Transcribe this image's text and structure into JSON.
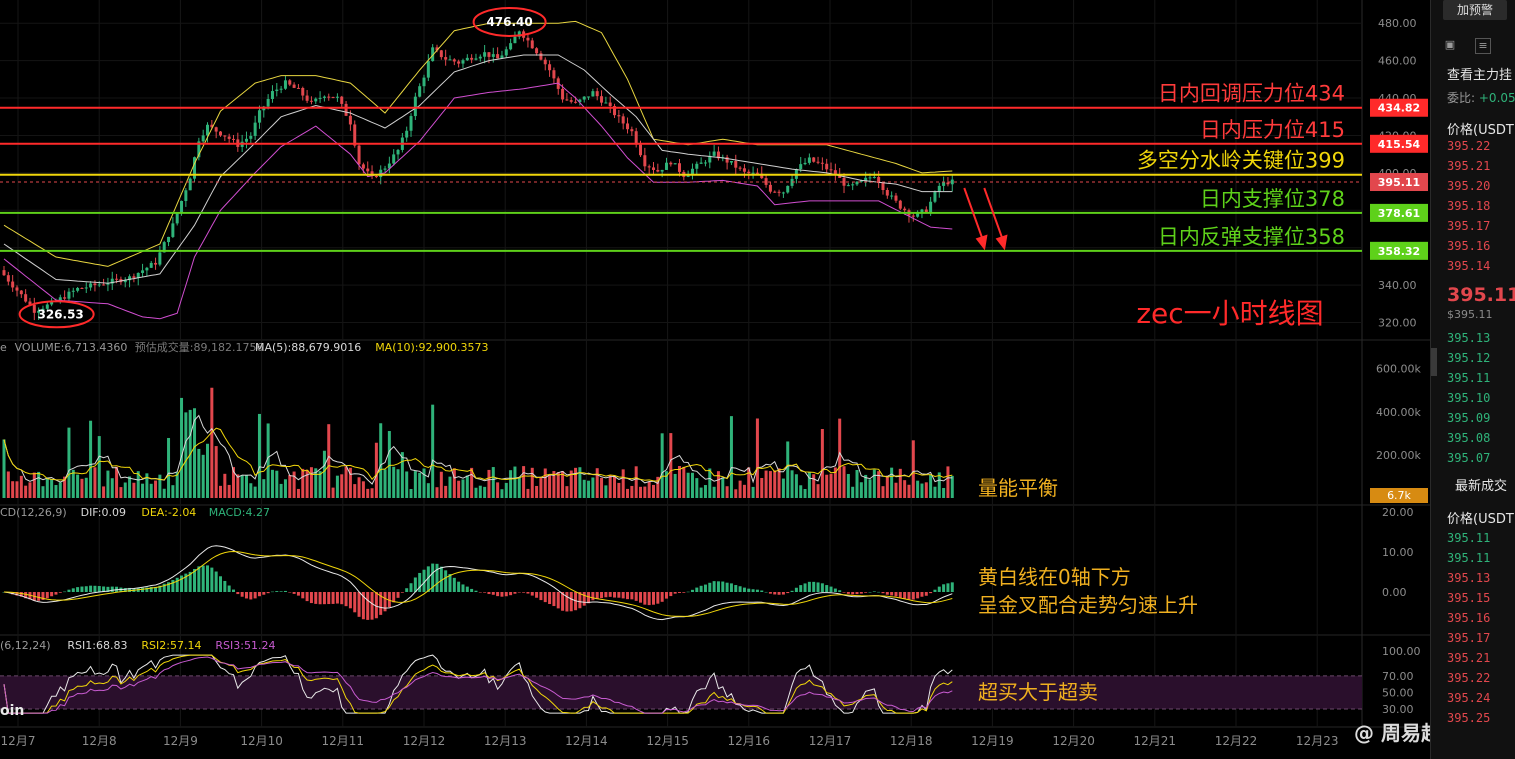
{
  "chart_data": {
    "type": "candlestick",
    "title": "zec一小时线图",
    "x_tick_labels": [
      "12月7",
      "12月8",
      "12月9",
      "12月10",
      "12月11",
      "12月12",
      "12月13",
      "12月14",
      "12月15",
      "12月16",
      "12月17",
      "12月18",
      "12月19",
      "12月20",
      "12月21",
      "12月22",
      "12月23"
    ],
    "price_axis": {
      "ticks": [
        "480.00",
        "460.00",
        "440.00",
        "420.00",
        "400.00",
        "380.00",
        "360.00",
        "340.00",
        "320.00"
      ],
      "range": [
        316,
        486
      ]
    },
    "key_prices": {
      "high": "476.40",
      "low": "326.53",
      "last": "395.11"
    },
    "price_path": [
      [
        0,
        348
      ],
      [
        3,
        340
      ],
      [
        6,
        332
      ],
      [
        8,
        326.53
      ],
      [
        12,
        330
      ],
      [
        18,
        338
      ],
      [
        24,
        341
      ],
      [
        30,
        344
      ],
      [
        36,
        352
      ],
      [
        40,
        372
      ],
      [
        44,
        398
      ],
      [
        46,
        418
      ],
      [
        48,
        425
      ],
      [
        52,
        420
      ],
      [
        55,
        415
      ],
      [
        58,
        420
      ],
      [
        60,
        432
      ],
      [
        63,
        443
      ],
      [
        66,
        448
      ],
      [
        69,
        444
      ],
      [
        72,
        437
      ],
      [
        75,
        442
      ],
      [
        78,
        440
      ],
      [
        81,
        427
      ],
      [
        83,
        405
      ],
      [
        86,
        397
      ],
      [
        89,
        403
      ],
      [
        92,
        412
      ],
      [
        94,
        423
      ],
      [
        96,
        440
      ],
      [
        98,
        452
      ],
      [
        100,
        466
      ],
      [
        103,
        461
      ],
      [
        106,
        459
      ],
      [
        109,
        462
      ],
      [
        112,
        464
      ],
      [
        115,
        461
      ],
      [
        118,
        468
      ],
      [
        120,
        476.4
      ],
      [
        124,
        465
      ],
      [
        127,
        455
      ],
      [
        130,
        440
      ],
      [
        133,
        437
      ],
      [
        137,
        443
      ],
      [
        140,
        437
      ],
      [
        143,
        429
      ],
      [
        146,
        422
      ],
      [
        149,
        405
      ],
      [
        152,
        401
      ],
      [
        155,
        406
      ],
      [
        158,
        399
      ],
      [
        162,
        405
      ],
      [
        165,
        410
      ],
      [
        169,
        405
      ],
      [
        172,
        400
      ],
      [
        175,
        399
      ],
      [
        178,
        391
      ],
      [
        181,
        390
      ],
      [
        184,
        402
      ],
      [
        187,
        407
      ],
      [
        190,
        404
      ],
      [
        193,
        399
      ],
      [
        196,
        392
      ],
      [
        199,
        395
      ],
      [
        202,
        399
      ],
      [
        205,
        389
      ],
      [
        208,
        382
      ],
      [
        211,
        377
      ],
      [
        214,
        380
      ],
      [
        217,
        393
      ],
      [
        219,
        395.11
      ]
    ],
    "bollinger": {
      "upper": [
        [
          0,
          372
        ],
        [
          12,
          355
        ],
        [
          24,
          350
        ],
        [
          36,
          362
        ],
        [
          44,
          405
        ],
        [
          50,
          433
        ],
        [
          58,
          448
        ],
        [
          64,
          452
        ],
        [
          72,
          452
        ],
        [
          80,
          448
        ],
        [
          88,
          432
        ],
        [
          96,
          455
        ],
        [
          104,
          476
        ],
        [
          112,
          480
        ],
        [
          120,
          480
        ],
        [
          128,
          480
        ],
        [
          132,
          481
        ],
        [
          138,
          475
        ],
        [
          144,
          450
        ],
        [
          150,
          418
        ],
        [
          158,
          415
        ],
        [
          166,
          418
        ],
        [
          174,
          415
        ],
        [
          182,
          415
        ],
        [
          190,
          415
        ],
        [
          198,
          410
        ],
        [
          206,
          405
        ],
        [
          212,
          400
        ],
        [
          219,
          401
        ]
      ],
      "middle": [
        [
          0,
          362
        ],
        [
          12,
          343
        ],
        [
          24,
          341
        ],
        [
          36,
          346
        ],
        [
          44,
          372
        ],
        [
          50,
          398
        ],
        [
          58,
          416
        ],
        [
          64,
          430
        ],
        [
          72,
          436
        ],
        [
          80,
          432
        ],
        [
          88,
          424
        ],
        [
          96,
          436
        ],
        [
          104,
          454
        ],
        [
          112,
          460
        ],
        [
          120,
          463
        ],
        [
          128,
          463
        ],
        [
          134,
          455
        ],
        [
          140,
          442
        ],
        [
          146,
          430
        ],
        [
          152,
          412
        ],
        [
          158,
          410
        ],
        [
          166,
          408
        ],
        [
          174,
          405
        ],
        [
          182,
          402
        ],
        [
          190,
          400
        ],
        [
          198,
          396
        ],
        [
          206,
          394
        ],
        [
          212,
          390
        ],
        [
          219,
          390
        ]
      ],
      "lower": [
        [
          0,
          354
        ],
        [
          12,
          332
        ],
        [
          24,
          330
        ],
        [
          32,
          323
        ],
        [
          36,
          322
        ],
        [
          40,
          325
        ],
        [
          44,
          355
        ],
        [
          50,
          380
        ],
        [
          58,
          400
        ],
        [
          64,
          414
        ],
        [
          72,
          425
        ],
        [
          80,
          410
        ],
        [
          84,
          398
        ],
        [
          88,
          400
        ],
        [
          96,
          417
        ],
        [
          104,
          440
        ],
        [
          112,
          443
        ],
        [
          120,
          445
        ],
        [
          128,
          448
        ],
        [
          132,
          440
        ],
        [
          138,
          425
        ],
        [
          144,
          408
        ],
        [
          150,
          395
        ],
        [
          158,
          395
        ],
        [
          166,
          396
        ],
        [
          174,
          393
        ],
        [
          178,
          383
        ],
        [
          186,
          385
        ],
        [
          194,
          385
        ],
        [
          202,
          385
        ],
        [
          208,
          378
        ],
        [
          214,
          371
        ],
        [
          219,
          370
        ]
      ]
    },
    "levels": [
      {
        "label": "日内回调压力位434",
        "value": 434.82,
        "tag": "434.82",
        "color": "#ff2a2a",
        "text_color": "#ff3b3b"
      },
      {
        "label": "日内压力位415",
        "value": 415.54,
        "tag": "415.54",
        "color": "#ff2a2a",
        "text_color": "#ff3b3b"
      },
      {
        "label": "多空分水岭关键位399",
        "value": 399.0,
        "tag": "",
        "color": "#f0d60a",
        "text_color": "#f0d60a"
      },
      {
        "label": "日内支撑位378",
        "value": 378.61,
        "tag": "378.61",
        "color": "#5ed11a",
        "text_color": "#5ed11a"
      },
      {
        "label": "日内反弹支撑位358",
        "value": 358.32,
        "tag": "358.32",
        "color": "#5ed11a",
        "text_color": "#5ed11a"
      }
    ],
    "volume": {
      "legend": [
        {
          "text": "e",
          "color": "#9a9a9a"
        },
        {
          "text": "VOLUME:6,713.4360",
          "color": "#9a9a9a"
        },
        {
          "text": "预估成交量:89,182.1756",
          "color": "#7a7a7a"
        },
        {
          "text": "MA(5):88,679.9016",
          "color": "#d8d8d8"
        },
        {
          "text": "MA(10):92,900.3573",
          "color": "#f0d60a"
        }
      ],
      "axis_ticks": [
        "600.00k",
        "400.00k",
        "200.00k"
      ],
      "last_tag": "6.7k",
      "note": "量能平衡"
    },
    "macd": {
      "legend": [
        {
          "text": "CD(12,26,9)",
          "color": "#9a9a9a"
        },
        {
          "text": "DIF:0.09",
          "color": "#d8d8d8"
        },
        {
          "text": "DEA:-2.04",
          "color": "#f0d60a"
        },
        {
          "text": "MACD:4.27",
          "color": "#2fb37a"
        }
      ],
      "axis_ticks": [
        "20.00",
        "10.00",
        "0.00"
      ],
      "note_lines": [
        "黄白线在0轴下方",
        "呈金叉配合走势匀速上升"
      ]
    },
    "rsi": {
      "legend": [
        {
          "text": "(6,12,24)",
          "color": "#9a9a9a"
        },
        {
          "text": "RSI1:68.83",
          "color": "#d8d8d8"
        },
        {
          "text": "RSI2:57.14",
          "color": "#f0d60a"
        },
        {
          "text": "RSI3:51.24",
          "color": "#c75bd0"
        }
      ],
      "axis_ticks": [
        "100.00",
        "70.00",
        "50.00",
        "30.00"
      ],
      "note": "超买大于超卖"
    }
  },
  "watermark": "@ 周易趋势",
  "edge_label": "oin",
  "side_panel": {
    "alert_button": "加预警",
    "main_orders_title": "查看主力挂",
    "commission_label": "委比:",
    "commission_value": "+0.05",
    "price_header": "价格(USDT",
    "asks": [
      "395.22",
      "395.21",
      "395.20",
      "395.18",
      "395.17",
      "395.16",
      "395.14"
    ],
    "last_price": "395.11",
    "last_price_usd": "$395.11",
    "bids": [
      "395.13",
      "395.12",
      "395.11",
      "395.10",
      "395.09",
      "395.08",
      "395.07"
    ],
    "latest_trades_title": "最新成交",
    "trades_header": "价格(USDT",
    "trades": [
      {
        "price": "395.11",
        "dir": "up"
      },
      {
        "price": "395.11",
        "dir": "up"
      },
      {
        "price": "395.13",
        "dir": "down"
      },
      {
        "price": "395.15",
        "dir": "down"
      },
      {
        "price": "395.16",
        "dir": "down"
      },
      {
        "price": "395.17",
        "dir": "down"
      },
      {
        "price": "395.21",
        "dir": "down"
      },
      {
        "price": "395.22",
        "dir": "down"
      },
      {
        "price": "395.24",
        "dir": "down"
      },
      {
        "price": "395.25",
        "dir": "down"
      }
    ]
  }
}
